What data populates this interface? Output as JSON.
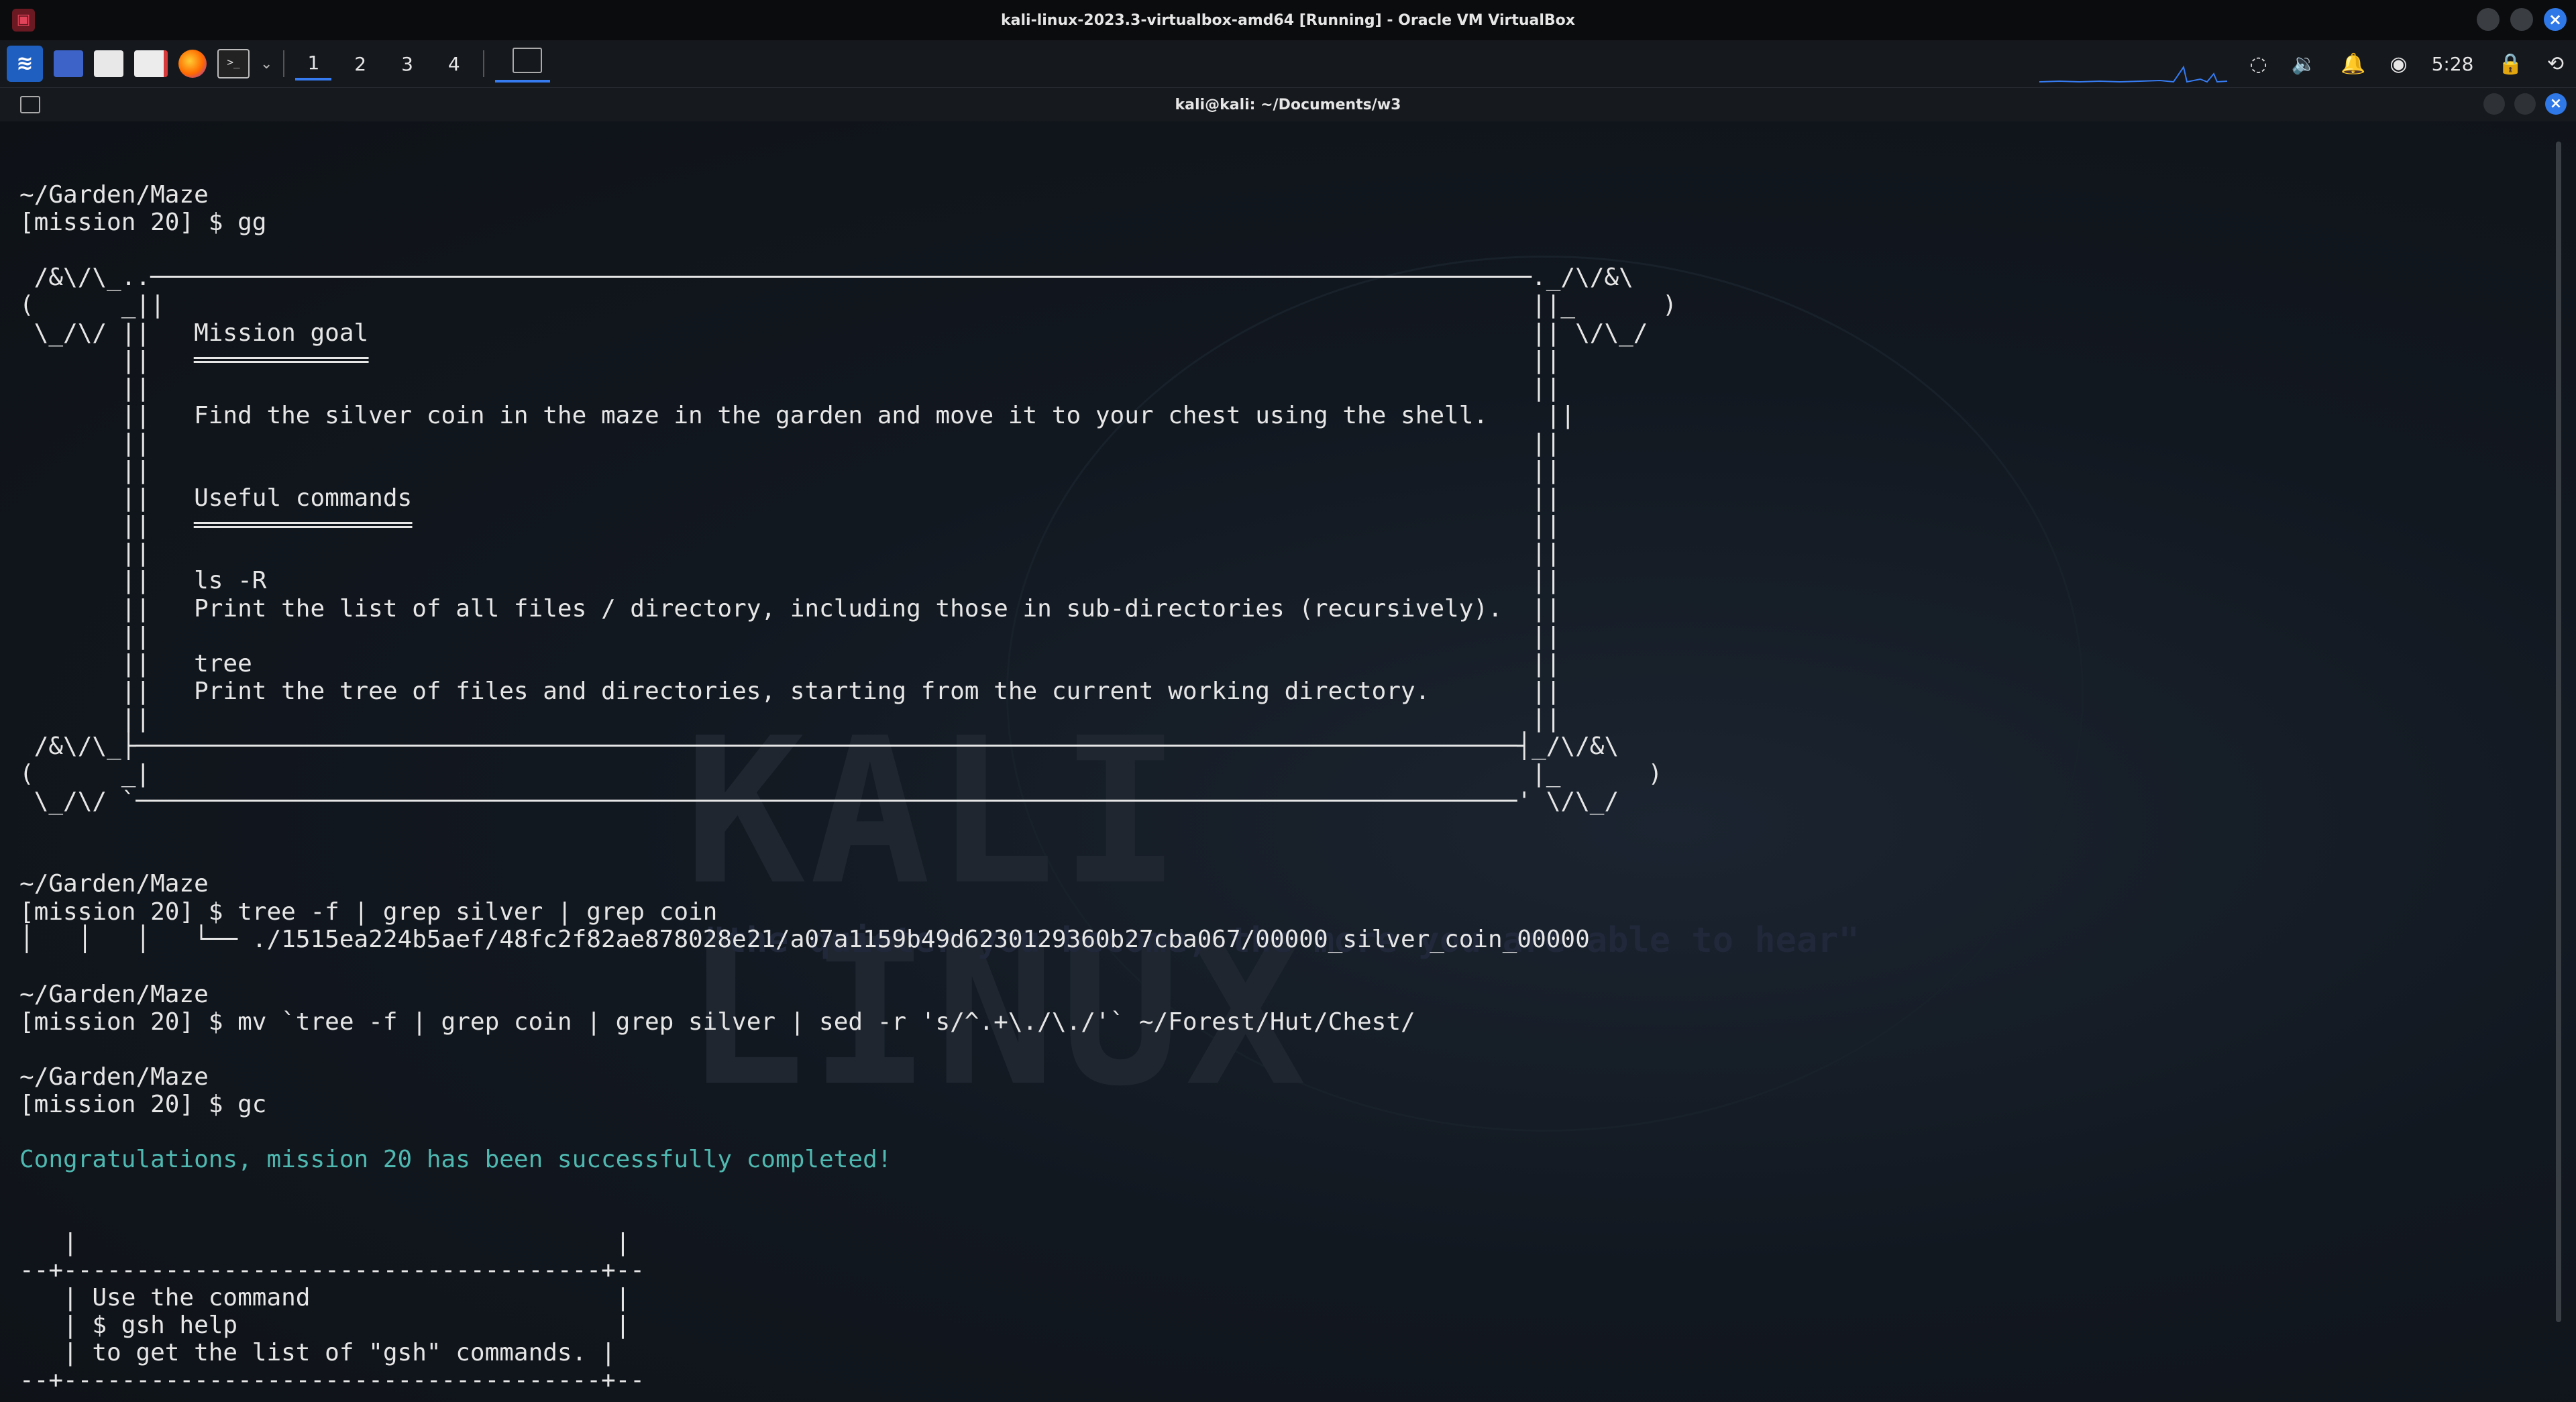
{
  "host": {
    "window_title": "kali-linux-2023.3-virtualbox-amd64 [Running] - Oracle VM VirtualBox",
    "app_icon": "virtualbox-icon"
  },
  "panel": {
    "workspaces": [
      "1",
      "2",
      "3",
      "4"
    ],
    "active_workspace": "1",
    "launchers": [
      "kali-menu-icon",
      "terminal-icon",
      "file-manager-icon",
      "text-editor-icon",
      "firefox-icon",
      "terminal-emulator-icon"
    ],
    "clock": "5:28",
    "tray_icons": [
      "network-icon",
      "volume-icon",
      "notifications-icon",
      "power-icon",
      "lock-icon",
      "logout-icon"
    ]
  },
  "terminal": {
    "title": "kali@kali: ~/Documents/w3",
    "accent": "#367bf0",
    "success_color": "#4fb8b0",
    "lines": [
      "",
      "~/Garden/Maze",
      "[mission 20] $ gg",
      "",
      " /&\\/\\_..───────────────────────────────────────────────────────────────────────────────────────────────._/\\/&\\",
      "(      _||                                                                                              ||_      )",
      " \\_/\\/ ||   Mission goal                                                                                || \\/\\_/",
      "       ||   ════════════                                                                                ||",
      "       ||                                                                                               ||",
      "       ||   Find the silver coin in the maze in the garden and move it to your chest using the shell.    ||",
      "       ||                                                                                               ||",
      "       ||                                                                                               ||",
      "       ||   Useful commands                                                                             ||",
      "       ||   ═══════════════                                                                             ||",
      "       ||                                                                                               ||",
      "       ||   ls -R                                                                                       ||",
      "       ||   Print the list of all files / directory, including those in sub-directories (recursively).  ||",
      "       ||                                                                                               ||",
      "       ||   tree                                                                                        ||",
      "       ||   Print the tree of files and directories, starting from the current working directory.       ||",
      "       ||                                                                                               ||",
      " /&\\/\\_├───────────────────────────────────────────────────────────────────────────────────────────────┤_/\\/&\\",
      "(      _|                                                                                               |_      )",
      " \\_/\\/ `───────────────────────────────────────────────────────────────────────────────────────────────' \\/\\_/",
      "",
      "",
      "~/Garden/Maze",
      "[mission 20] $ tree -f | grep silver | grep coin",
      "│   │   │   └── ./1515ea224b5aef/48fc2f82ae878028e21/a07a1159b49d6230129360b27cba067/00000_silver_coin_00000",
      "",
      "~/Garden/Maze",
      "[mission 20] $ mv `tree -f | grep coin | grep silver | sed -r 's/^.+\\./\\./'` ~/Forest/Hut/Chest/",
      "",
      "~/Garden/Maze",
      "[mission 20] $ gc",
      "",
      "Congratulations, mission 20 has been successfully completed!",
      "",
      "",
      "   |                                     |",
      "--+-------------------------------------+--",
      "   | Use the command                     |",
      "   | $ gsh help                          |",
      "   | to get the list of \"gsh\" commands. |",
      "--+-------------------------------------+--"
    ]
  }
}
